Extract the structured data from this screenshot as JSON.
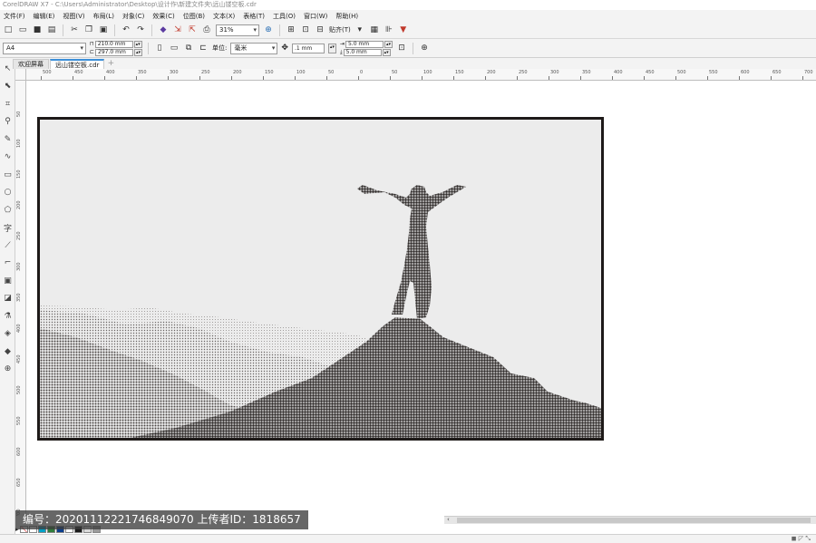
{
  "window": {
    "title": "CorelDRAW X7 - C:\\Users\\Administrator\\Desktop\\设计作\\新建文件夹\\远山镂空板.cdr"
  },
  "menu": [
    "文件(F)",
    "编辑(E)",
    "视图(V)",
    "布局(L)",
    "对象(C)",
    "效果(C)",
    "位图(B)",
    "文本(X)",
    "表格(T)",
    "工具(O)",
    "窗口(W)",
    "帮助(H)"
  ],
  "toolbar": {
    "zoom": "31%",
    "snap_label": "贴齐(T)"
  },
  "property_bar": {
    "page_size": "A4",
    "width": "210.0 mm",
    "height": "297.0 mm",
    "units_label": "单位:",
    "units_value": "毫米",
    "nudge": ".1 mm",
    "dup_x": "5.0 mm",
    "dup_y": "5.0 mm"
  },
  "tabs": [
    {
      "label": "欢迎屏幕"
    },
    {
      "label": "远山镂空板.cdr"
    }
  ],
  "ruler_top": [
    "500",
    "450",
    "400",
    "350",
    "300",
    "250",
    "200",
    "150",
    "100",
    "50",
    "0",
    "50",
    "100",
    "150",
    "200",
    "250",
    "300",
    "350",
    "400",
    "450",
    "500",
    "550",
    "600",
    "650",
    "700"
  ],
  "ruler_left": [
    "50",
    "100",
    "150",
    "200",
    "250",
    "300",
    "350",
    "400",
    "450",
    "500",
    "550",
    "600",
    "650",
    "700"
  ],
  "artwork": {
    "description_colors": {
      "frame": "#1e1a19",
      "background": "#ececec",
      "figure": "#3a3634"
    }
  },
  "watermark": "编号：20201112221746849070 上传者ID：1818657",
  "palette": [
    "#ffffff",
    "#00a0c6",
    "#2f7d3a",
    "#0b3d8c",
    "#ffffff",
    "#1a1a1a",
    "#d9d9d9",
    "#9a9a9a"
  ]
}
